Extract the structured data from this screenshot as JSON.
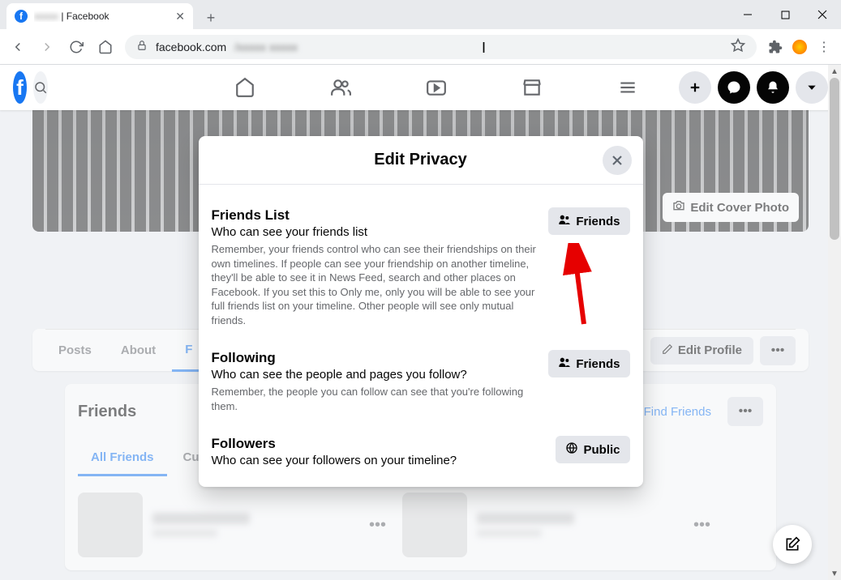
{
  "browser": {
    "tab_title_suffix": "| Facebook",
    "url_host": "facebook.com"
  },
  "fb_nav": [
    "home",
    "friends",
    "watch",
    "marketplace",
    "menu"
  ],
  "cover_button": "Edit Cover Photo",
  "profile_tabs": {
    "posts": "Posts",
    "about": "About",
    "friends_initial": "F"
  },
  "edit_profile": "Edit Profile",
  "friends_card": {
    "title": "Friends",
    "find_friends": "Find Friends",
    "all_friends": "All Friends",
    "current_prefix": "Curr"
  },
  "modal": {
    "title": "Edit Privacy",
    "rows": [
      {
        "heading": "Friends List",
        "sub": "Who can see your friends list",
        "desc": "Remember, your friends control who can see their friendships on their own timelines. If people can see your friendship on another timeline, they'll be able to see it in News Feed, search and other places on Facebook. If you set this to Only me, only you will be able to see your full friends list on your timeline. Other people will see only mutual friends.",
        "button": "Friends",
        "icon": "friends"
      },
      {
        "heading": "Following",
        "sub": "Who can see the people and pages you follow?",
        "desc": "Remember, the people you can follow can see that you're following them.",
        "button": "Friends",
        "icon": "friends"
      },
      {
        "heading": "Followers",
        "sub": "Who can see your followers on your timeline?",
        "desc": "",
        "button": "Public",
        "icon": "public"
      }
    ]
  }
}
